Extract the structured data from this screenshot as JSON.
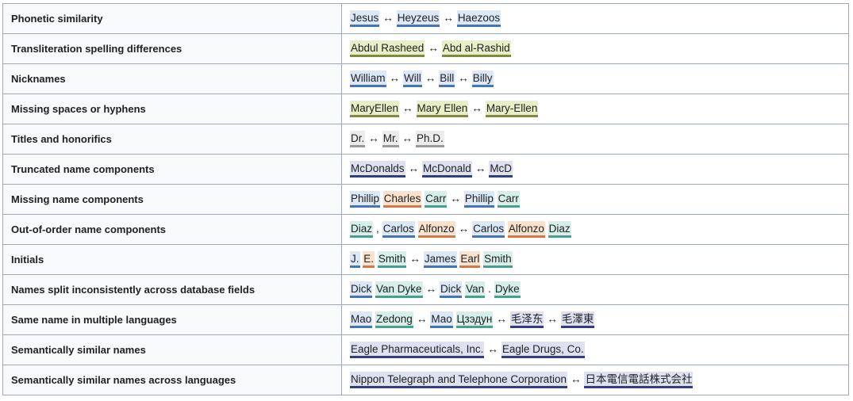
{
  "colors": {
    "blue": {
      "bg": "#dbe8f8",
      "line": "#3a77c9"
    },
    "olive": {
      "bg": "#e9efc4",
      "line": "#7f8c32"
    },
    "gray": {
      "bg": "#ececec",
      "line": "#9a9a9a"
    },
    "navy": {
      "bg": "#dde1f1",
      "line": "#2e3f86"
    },
    "orange": {
      "bg": "#fbe2cc",
      "line": "#e3733a"
    },
    "teal": {
      "bg": "#d5efe9",
      "line": "#3aa593"
    }
  },
  "arrow": "↔",
  "rows": [
    {
      "label": "Phonetic similarity",
      "groups": [
        [
          {
            "t": "Jesus",
            "c": "blue"
          }
        ],
        [
          {
            "t": "Heyzeus",
            "c": "blue"
          }
        ],
        [
          {
            "t": "Haezoos",
            "c": "blue"
          }
        ]
      ]
    },
    {
      "label": "Transliteration spelling differences",
      "groups": [
        [
          {
            "t": "Abdul Rasheed",
            "c": "olive"
          }
        ],
        [
          {
            "t": "Abd al-Rashid",
            "c": "olive"
          }
        ]
      ]
    },
    {
      "label": "Nicknames",
      "groups": [
        [
          {
            "t": "William",
            "c": "blue"
          }
        ],
        [
          {
            "t": "Will",
            "c": "blue"
          }
        ],
        [
          {
            "t": "Bill",
            "c": "blue"
          }
        ],
        [
          {
            "t": "Billy",
            "c": "blue"
          }
        ]
      ]
    },
    {
      "label": "Missing spaces or hyphens",
      "groups": [
        [
          {
            "t": "MaryEllen",
            "c": "olive"
          }
        ],
        [
          {
            "t": "Mary Ellen",
            "c": "olive"
          }
        ],
        [
          {
            "t": "Mary-Ellen",
            "c": "olive"
          }
        ]
      ]
    },
    {
      "label": "Titles and honorifics",
      "groups": [
        [
          {
            "t": "Dr.",
            "c": "gray"
          }
        ],
        [
          {
            "t": "Mr.",
            "c": "gray"
          }
        ],
        [
          {
            "t": "Ph.D.",
            "c": "gray"
          }
        ]
      ]
    },
    {
      "label": "Truncated name components",
      "groups": [
        [
          {
            "t": "McDonalds",
            "c": "navy"
          }
        ],
        [
          {
            "t": "McDonald",
            "c": "navy"
          }
        ],
        [
          {
            "t": "McD",
            "c": "navy"
          }
        ]
      ]
    },
    {
      "label": "Missing name components",
      "groups": [
        [
          {
            "t": "Phillip",
            "c": "blue"
          },
          {
            "t": "Charles",
            "c": "orange"
          },
          {
            "t": "Carr",
            "c": "teal"
          }
        ],
        [
          {
            "t": "Phillip",
            "c": "blue"
          },
          {
            "t": "Carr",
            "c": "teal"
          }
        ]
      ]
    },
    {
      "label": "Out-of-order name components",
      "groups": [
        [
          {
            "t": "Diaz",
            "c": "teal"
          },
          {
            "sep": ","
          },
          {
            "t": "Carlos",
            "c": "blue"
          },
          {
            "t": "Alfonzo",
            "c": "orange"
          }
        ],
        [
          {
            "t": "Carlos",
            "c": "blue"
          },
          {
            "t": "Alfonzo",
            "c": "orange"
          },
          {
            "t": "Diaz",
            "c": "teal"
          }
        ]
      ]
    },
    {
      "label": "Initials",
      "groups": [
        [
          {
            "t": "J.",
            "c": "blue"
          },
          {
            "t": "E.",
            "c": "orange"
          },
          {
            "t": "Smith",
            "c": "teal"
          }
        ],
        [
          {
            "t": "James",
            "c": "blue"
          },
          {
            "t": "Earl",
            "c": "orange"
          },
          {
            "t": "Smith",
            "c": "teal"
          }
        ]
      ]
    },
    {
      "label": "Names split inconsistently across database fields",
      "groups": [
        [
          {
            "t": "Dick",
            "c": "blue"
          },
          {
            "t": "Van Dyke",
            "c": "teal"
          }
        ],
        [
          {
            "t": "Dick",
            "c": "blue"
          },
          {
            "t": "Van",
            "c": "teal"
          },
          {
            "sep": "."
          },
          {
            "t": "Dyke",
            "c": "teal"
          }
        ]
      ]
    },
    {
      "label": "Same name in multiple languages",
      "groups": [
        [
          {
            "t": "Mao",
            "c": "blue"
          },
          {
            "t": "Zedong",
            "c": "teal"
          }
        ],
        [
          {
            "t": "Мао",
            "c": "blue"
          },
          {
            "t": "Цзэдун",
            "c": "teal"
          }
        ],
        [
          {
            "t": "毛泽东",
            "c": "navy"
          }
        ],
        [
          {
            "t": "毛澤東",
            "c": "navy"
          }
        ]
      ]
    },
    {
      "label": "Semantically similar names",
      "groups": [
        [
          {
            "t": "Eagle Pharmaceuticals, Inc.",
            "c": "navy"
          }
        ],
        [
          {
            "t": "Eagle Drugs, Co.",
            "c": "navy"
          }
        ]
      ]
    },
    {
      "label": "Semantically similar names across languages",
      "groups": [
        [
          {
            "t": "Nippon Telegraph and Telephone Corporation",
            "c": "navy"
          }
        ],
        [
          {
            "t": "日本電信電話株式会社",
            "c": "navy"
          }
        ]
      ]
    }
  ]
}
